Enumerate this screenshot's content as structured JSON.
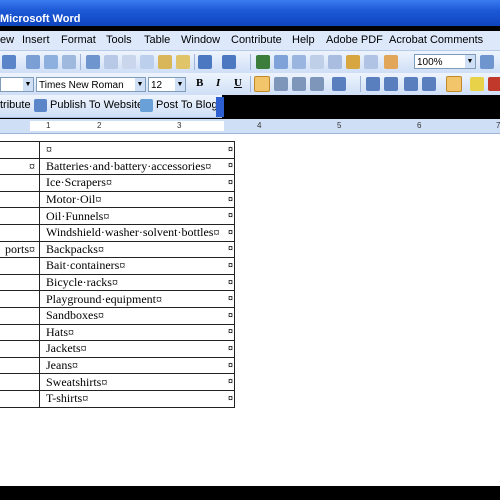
{
  "window": {
    "title": "Microsoft Word"
  },
  "menu": {
    "items": [
      "ew",
      "Insert",
      "Format",
      "Tools",
      "Table",
      "Window",
      "Contribute",
      "Help",
      "Adobe PDF",
      "Acrobat Comments"
    ]
  },
  "formatting": {
    "font_name": "Times New Roman",
    "font_size": "12",
    "bold": "B",
    "italic": "I",
    "underline": "U"
  },
  "standard_toolbar": {
    "zoom": "100%"
  },
  "contribute_toolbar": {
    "contribute_label": "tribute",
    "publish_label": "Publish To Website",
    "post_label": "Post To Blog"
  },
  "ruler": {
    "numbers": [
      "1",
      "2",
      "3",
      "4",
      "5",
      "6",
      "7"
    ]
  },
  "table": {
    "rows": [
      {
        "c1": "",
        "c2": "¤"
      },
      {
        "c1": "¤",
        "c2": "Batteries·and·battery·accessories¤"
      },
      {
        "c1": "",
        "c2": "Ice·Scrapers¤"
      },
      {
        "c1": "",
        "c2": "Motor·Oil¤"
      },
      {
        "c1": "",
        "c2": "Oil·Funnels¤"
      },
      {
        "c1": "",
        "c2": "Windshield·washer·solvent·bottles¤"
      },
      {
        "c1": "ports¤",
        "c2": "Backpacks¤"
      },
      {
        "c1": "",
        "c2": "Bait·containers¤"
      },
      {
        "c1": "",
        "c2": "Bicycle·racks¤"
      },
      {
        "c1": "",
        "c2": "Playground·equipment¤"
      },
      {
        "c1": "",
        "c2": "Sandboxes¤"
      },
      {
        "c1": "",
        "c2": "Hats¤"
      },
      {
        "c1": "",
        "c2": "Jackets¤"
      },
      {
        "c1": "",
        "c2": "Jeans¤"
      },
      {
        "c1": "",
        "c2": "Sweatshirts¤"
      },
      {
        "c1": "",
        "c2": "T-shirts¤"
      }
    ],
    "row_end_mark": "¤"
  }
}
